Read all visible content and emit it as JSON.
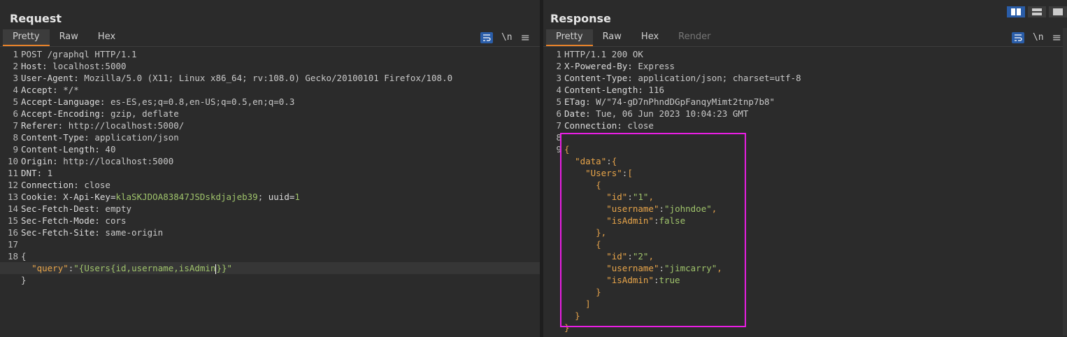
{
  "request": {
    "title": "Request",
    "tabs": [
      "Pretty",
      "Raw",
      "Hex"
    ],
    "active_tab": "Pretty",
    "tools": {
      "newline": "\\n"
    },
    "lines": [
      {
        "n": "1",
        "name": "",
        "value": "POST /graphql HTTP/1.1"
      },
      {
        "n": "2",
        "name": "Host:",
        "value": " localhost:5000"
      },
      {
        "n": "3",
        "name": "User-Agent:",
        "value": " Mozilla/5.0 (X11; Linux x86_64; rv:108.0) Gecko/20100101 Firefox/108.0"
      },
      {
        "n": "4",
        "name": "Accept:",
        "value": " */*"
      },
      {
        "n": "5",
        "name": "Accept-Language:",
        "value": " es-ES,es;q=0.8,en-US;q=0.5,en;q=0.3"
      },
      {
        "n": "6",
        "name": "Accept-Encoding:",
        "value": " gzip, deflate"
      },
      {
        "n": "7",
        "name": "Referer:",
        "value": " http://localhost:5000/"
      },
      {
        "n": "8",
        "name": "Content-Type:",
        "value": " application/json"
      },
      {
        "n": "9",
        "name": "Content-Length:",
        "value": " 40"
      },
      {
        "n": "10",
        "name": "Origin:",
        "value": " http://localhost:5000"
      },
      {
        "n": "11",
        "name": "DNT:",
        "value": " 1"
      },
      {
        "n": "12",
        "name": "Connection:",
        "value": " close"
      }
    ],
    "cookie": {
      "n": "13",
      "name": "Cookie:",
      "k1": "X-Api-Key",
      "v1": "klaSKJDOA83847JSDskdjajeb39",
      "sep": "; ",
      "k2": "uuid",
      "v2": "1"
    },
    "lines2": [
      {
        "n": "14",
        "name": "Sec-Fetch-Dest:",
        "value": " empty"
      },
      {
        "n": "15",
        "name": "Sec-Fetch-Mode:",
        "value": " cors"
      },
      {
        "n": "16",
        "name": "Sec-Fetch-Site:",
        "value": " same-origin"
      },
      {
        "n": "17",
        "name": "",
        "value": ""
      }
    ],
    "body": {
      "n": "18",
      "open": "{",
      "key": "\"query\"",
      "colon": ":",
      "value_a": "\"{Users{id,username,isAdmin",
      "value_b": "}}\"",
      "close": "}"
    }
  },
  "response": {
    "title": "Response",
    "tabs": [
      "Pretty",
      "Raw",
      "Hex",
      "Render"
    ],
    "active_tab": "Pretty",
    "tools": {
      "newline": "\\n"
    },
    "lines": [
      {
        "n": "1",
        "name": "",
        "value": "HTTP/1.1 200 OK"
      },
      {
        "n": "2",
        "name": "X-Powered-By:",
        "value": " Express"
      },
      {
        "n": "3",
        "name": "Content-Type:",
        "value": " application/json; charset=utf-8"
      },
      {
        "n": "4",
        "name": "Content-Length:",
        "value": " 116"
      },
      {
        "n": "5",
        "name": "ETag:",
        "value": " W/\"74-gD7nPhndDGpFanqyMimt2tnp7b8\""
      },
      {
        "n": "6",
        "name": "Date:",
        "value": " Tue, 06 Jun 2023 10:04:23 GMT"
      },
      {
        "n": "7",
        "name": "Connection:",
        "value": " close"
      },
      {
        "n": "8",
        "name": "",
        "value": ""
      }
    ],
    "json_lines": [
      {
        "n": "9",
        "ind": "",
        "k": "",
        "p": "",
        "v": "",
        "t": "{"
      },
      {
        "n": "",
        "ind": "  ",
        "k": "\"data\"",
        "p": ":",
        "v": "",
        "t": "{"
      },
      {
        "n": "",
        "ind": "    ",
        "k": "\"Users\"",
        "p": ":",
        "v": "",
        "t": "["
      },
      {
        "n": "",
        "ind": "      ",
        "k": "",
        "p": "",
        "v": "",
        "t": "{"
      },
      {
        "n": "",
        "ind": "        ",
        "k": "\"id\"",
        "p": ":",
        "v": "\"1\"",
        "t": ","
      },
      {
        "n": "",
        "ind": "        ",
        "k": "\"username\"",
        "p": ":",
        "v": "\"johndoe\"",
        "t": ","
      },
      {
        "n": "",
        "ind": "        ",
        "k": "\"isAdmin\"",
        "p": ":",
        "v": "false",
        "t": ""
      },
      {
        "n": "",
        "ind": "      ",
        "k": "",
        "p": "",
        "v": "",
        "t": "},"
      },
      {
        "n": "",
        "ind": "      ",
        "k": "",
        "p": "",
        "v": "",
        "t": "{"
      },
      {
        "n": "",
        "ind": "        ",
        "k": "\"id\"",
        "p": ":",
        "v": "\"2\"",
        "t": ","
      },
      {
        "n": "",
        "ind": "        ",
        "k": "\"username\"",
        "p": ":",
        "v": "\"jimcarry\"",
        "t": ","
      },
      {
        "n": "",
        "ind": "        ",
        "k": "\"isAdmin\"",
        "p": ":",
        "v": "true",
        "t": ""
      },
      {
        "n": "",
        "ind": "      ",
        "k": "",
        "p": "",
        "v": "",
        "t": "}"
      },
      {
        "n": "",
        "ind": "    ",
        "k": "",
        "p": "",
        "v": "",
        "t": "]"
      },
      {
        "n": "",
        "ind": "  ",
        "k": "",
        "p": "",
        "v": "",
        "t": "}"
      },
      {
        "n": "",
        "ind": "",
        "k": "",
        "p": "",
        "v": "",
        "t": "}"
      }
    ]
  },
  "colors": {
    "accent": "#e8822a",
    "highlight": "#e91ee3",
    "button": "#2a5da8"
  }
}
